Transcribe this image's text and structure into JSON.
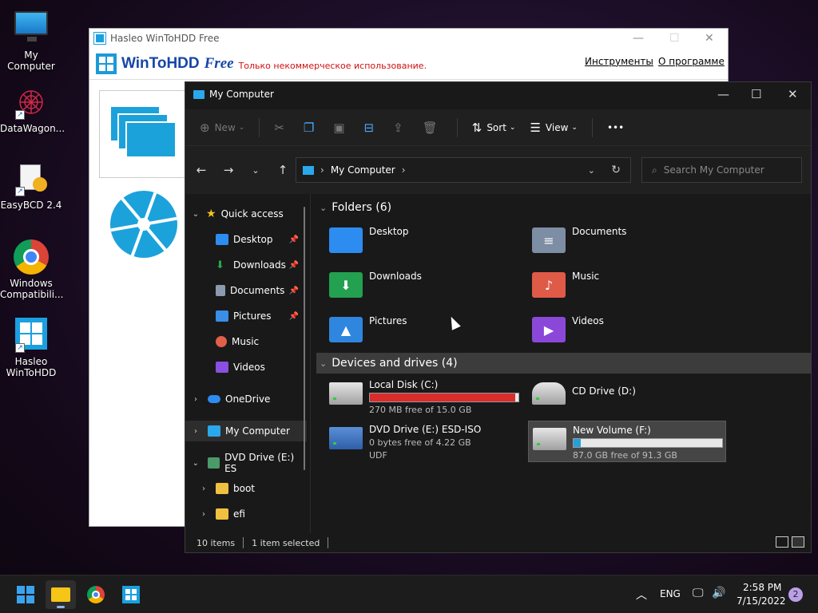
{
  "desktop": {
    "icons": [
      {
        "label": "My Computer",
        "icon": "monitor-icon"
      },
      {
        "label": "DataWagon...",
        "icon": "datawagon-icon"
      },
      {
        "label": "EasyBCD 2.4",
        "icon": "easybcd-icon"
      },
      {
        "label": "Windows Compatibili...",
        "icon": "chrome-icon"
      },
      {
        "label": "Hasleo WinToHDD",
        "icon": "wintohdd-icon"
      }
    ]
  },
  "wintohdd": {
    "title": "Hasleo WinToHDD Free",
    "brand": "WinToHDD",
    "edition": "Free",
    "notice": "Только некоммерческое использование.",
    "menu": [
      "Инструменты",
      "О программе"
    ]
  },
  "explorer": {
    "title": "My Computer",
    "toolbar": {
      "new_label": "New",
      "sort_label": "Sort",
      "view_label": "View",
      "more_label": "•••"
    },
    "address": "My Computer",
    "search_placeholder": "Search My Computer",
    "sidebar": {
      "quick_access": "Quick access",
      "pinned": [
        {
          "label": "Desktop",
          "color": "#2d8cf0"
        },
        {
          "label": "Downloads",
          "color": "#2ca84a"
        },
        {
          "label": "Documents",
          "color": "#8a9bb0"
        },
        {
          "label": "Pictures",
          "color": "#3a8ee6"
        },
        {
          "label": "Music",
          "color": "#e0604a"
        },
        {
          "label": "Videos",
          "color": "#8a4ee0"
        }
      ],
      "onedrive": "OneDrive",
      "my_computer": "My Computer",
      "dvd": "DVD Drive (E:) ES",
      "sub": [
        "boot",
        "efi"
      ]
    },
    "folders_header": "Folders (6)",
    "folders": [
      {
        "label": "Desktop",
        "color": "#2d8cf0",
        "icon": "desktop-folder-icon"
      },
      {
        "label": "Documents",
        "color": "#7d8da3",
        "icon": "documents-folder-icon"
      },
      {
        "label": "Downloads",
        "color": "#23a050",
        "icon": "downloads-folder-icon"
      },
      {
        "label": "Music",
        "color": "#e05a48",
        "icon": "music-folder-icon"
      },
      {
        "label": "Pictures",
        "color": "#2f86de",
        "icon": "pictures-folder-icon"
      },
      {
        "label": "Videos",
        "color": "#8b48d8",
        "icon": "videos-folder-icon"
      }
    ],
    "devices_header": "Devices and drives (4)",
    "drives": [
      {
        "name": "Local Disk (C:)",
        "free": "270 MB free of 15.0 GB",
        "used_fraction": 0.98,
        "bar_color": "#d92c2c"
      },
      {
        "name": "CD Drive (D:)"
      },
      {
        "name": "DVD Drive (E:) ESD-ISO",
        "free": "0 bytes free of 4.22 GB",
        "fs": "UDF"
      },
      {
        "name": "New Volume (F:)",
        "free": "87.0 GB free of 91.3 GB",
        "used_fraction": 0.05,
        "bar_color": "#26a0da"
      }
    ],
    "status": {
      "items": "10 items",
      "selected": "1 item selected"
    }
  },
  "taskbar": {
    "lang": "ENG",
    "time": "2:58 PM",
    "date": "7/15/2022",
    "badge": "2"
  }
}
